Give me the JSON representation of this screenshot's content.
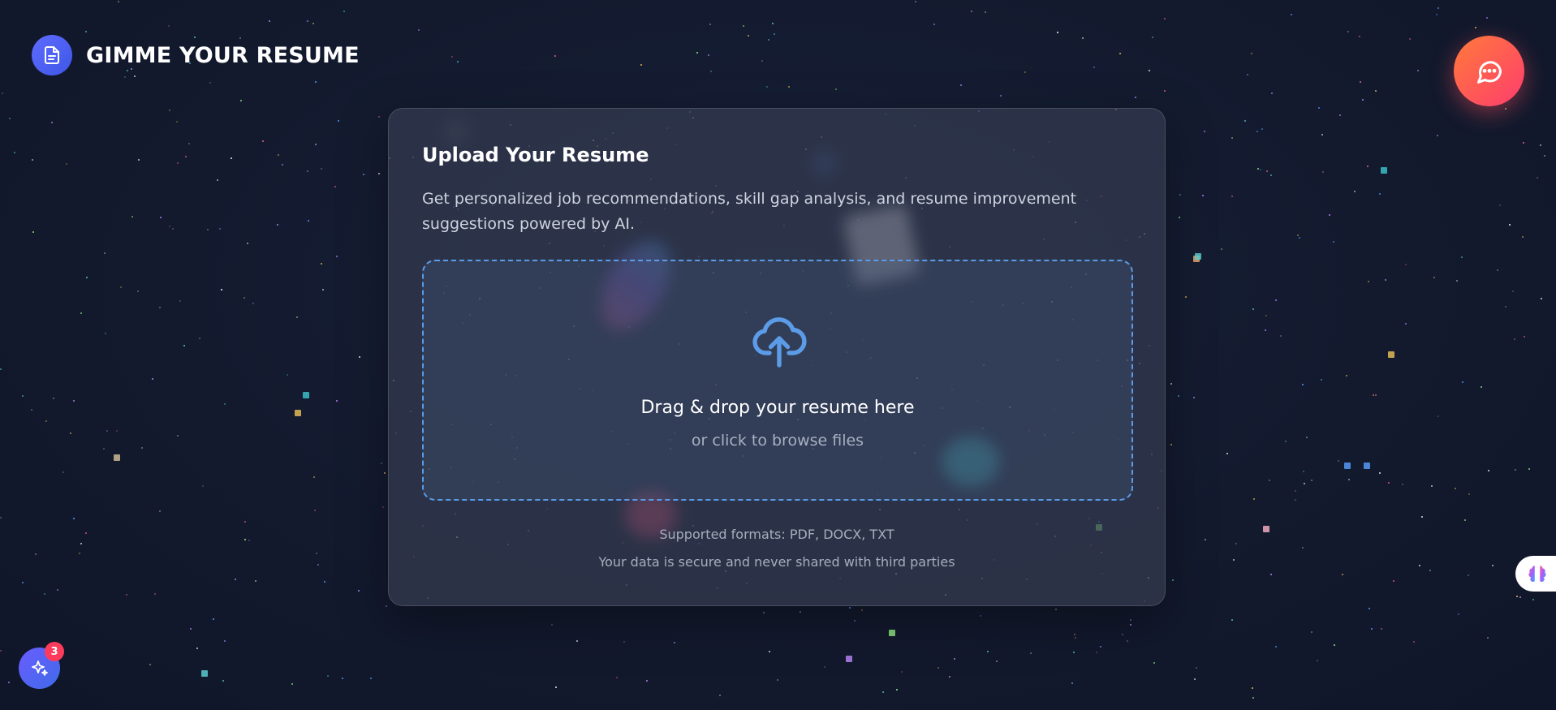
{
  "header": {
    "app_title": "GIMME YOUR RESUME",
    "logo_icon": "document-icon"
  },
  "chat_button": {
    "icon": "chat-bubble-icon"
  },
  "upload_card": {
    "title": "Upload Your Resume",
    "description": "Get personalized job recommendations, skill gap analysis, and resume improvement suggestions powered by AI.",
    "dropzone": {
      "icon": "cloud-upload-icon",
      "title": "Drag & drop your resume here",
      "subtitle": "or click to browse files"
    },
    "supported_formats": "Supported formats: PDF, DOCX, TXT",
    "security_note": "Your data is secure and never shared with third parties"
  },
  "side_tab": {
    "icon": "brain-icon"
  },
  "ai_assistant": {
    "icon": "sparkles-icon",
    "badge_count": "3"
  },
  "colors": {
    "background": "#131a2e",
    "accent_blue": "#5b9be8",
    "brand_gradient": "#5f6bff",
    "chat_gradient": "#ff5a50",
    "badge": "#ff3b5c"
  }
}
